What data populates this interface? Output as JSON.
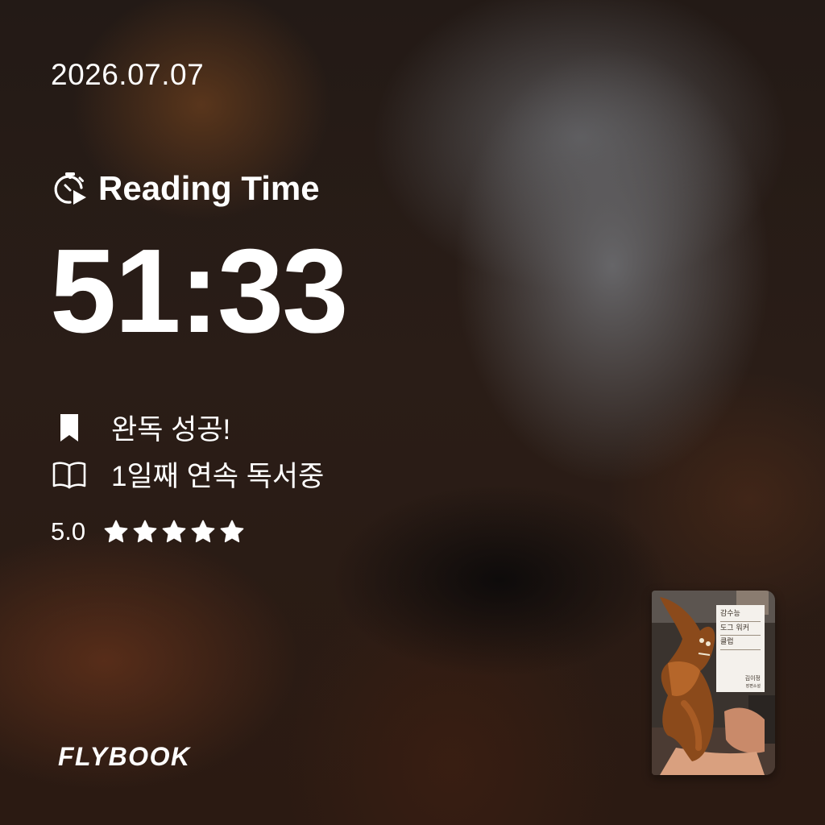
{
  "date": "2026.07.07",
  "reading_time": {
    "label": "Reading Time",
    "value": "51:33",
    "icon": "stopwatch-play-icon"
  },
  "status": [
    {
      "icon": "bookmark-icon",
      "text": "완독 성공!"
    },
    {
      "icon": "open-book-icon",
      "text": "1일째 연속 독서중"
    }
  ],
  "rating": {
    "value": "5.0",
    "stars_filled": 5,
    "stars_total": 5
  },
  "brand": "FLYBOOK",
  "book": {
    "cover_title_lines": [
      "감수능",
      "도그 워커",
      "클럽"
    ],
    "cover_author": "김이정",
    "cover_subtitle": "장편소설"
  },
  "colors": {
    "text": "#ffffff",
    "background_dark": "#231a16",
    "background_grey": "#69696c",
    "background_brown": "#5c371c"
  }
}
